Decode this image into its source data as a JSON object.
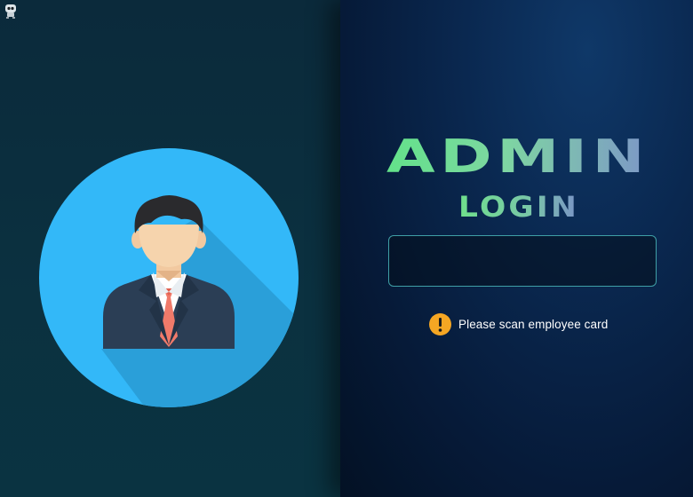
{
  "title": {
    "line1": "ADMIN",
    "line2": "LOGIN"
  },
  "card_input": {
    "value": "",
    "placeholder": ""
  },
  "status": {
    "icon": "warning-icon",
    "message": "Please scan employee card"
  },
  "colors": {
    "left_panel_bg": "#0b2f3e",
    "right_panel_bg": "#072145",
    "avatar_circle": "#33b8f8",
    "title_green": "#6fdc86",
    "title_blue": "#7fa1c4",
    "input_border": "#3f9fa6",
    "warning": "#f5a623"
  }
}
